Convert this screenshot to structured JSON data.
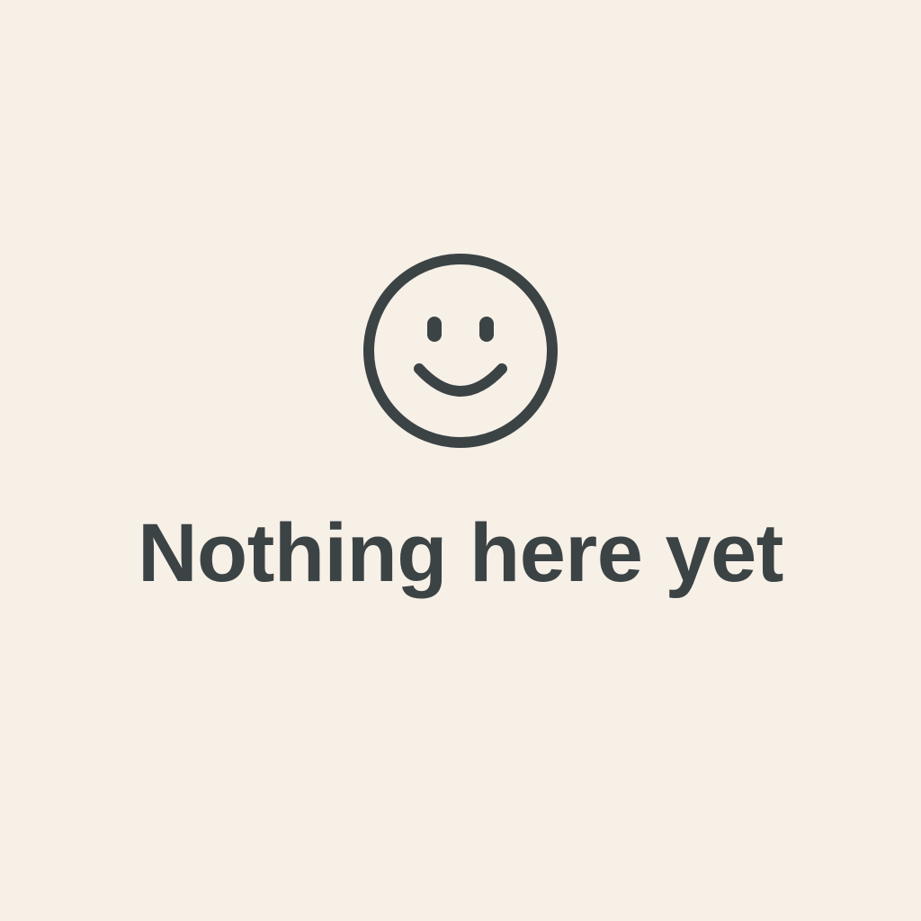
{
  "empty_state": {
    "icon": "smiley-face-icon",
    "title": "Nothing here yet"
  },
  "colors": {
    "background": "#f6f0e7",
    "foreground": "#3c4345"
  }
}
